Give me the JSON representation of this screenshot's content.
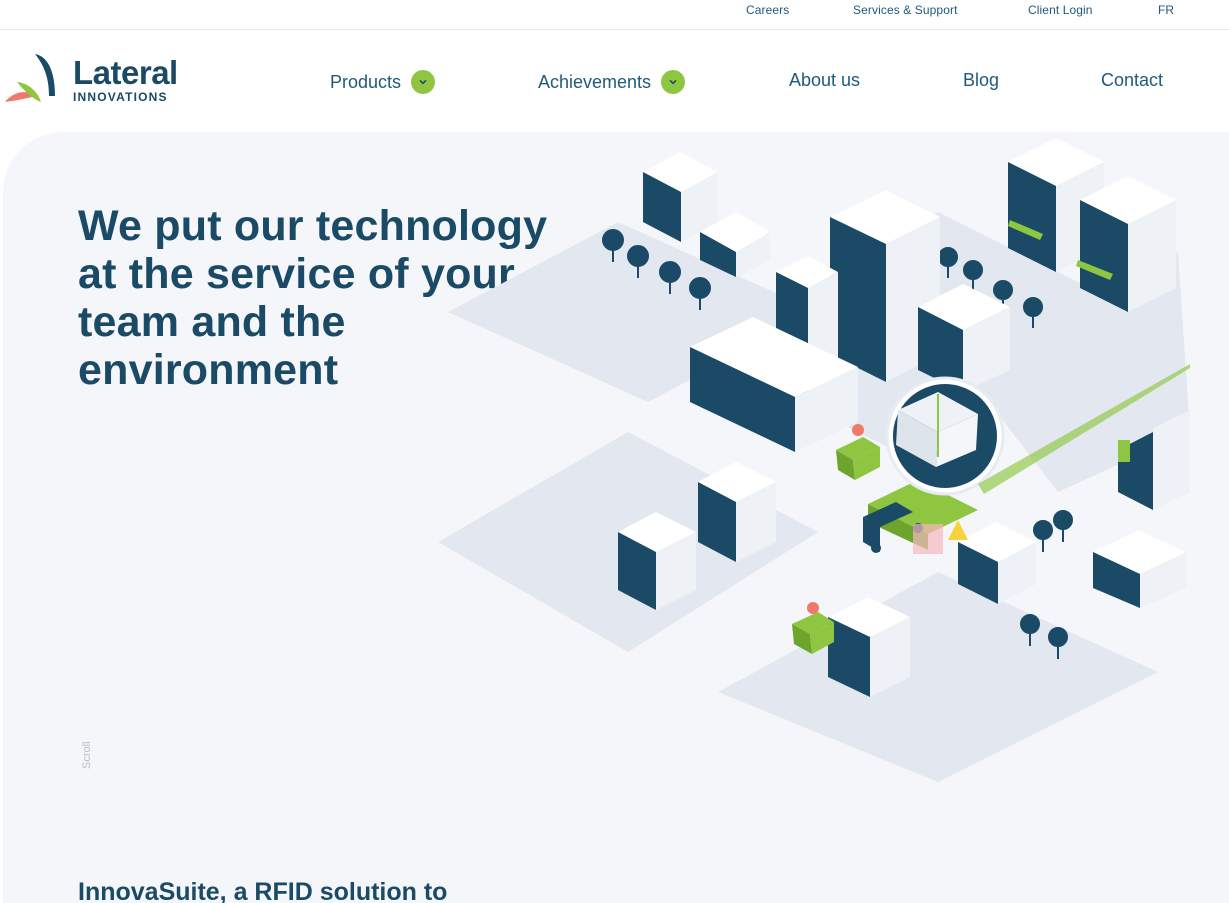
{
  "utility": {
    "careers": "Careers",
    "support": "Services & Support",
    "login": "Client Login",
    "lang": "FR"
  },
  "brand": {
    "name": "Lateral",
    "tagline": "INNOVATIONS"
  },
  "nav": {
    "products": "Products",
    "achievements": "Achievements",
    "about": "About us",
    "blog": "Blog",
    "contact": "Contact"
  },
  "hero": {
    "title": "We put our technology at the service of your team and the environment",
    "scroll": "Scroll"
  },
  "next_section": {
    "title": "InnovaSuite, a RFID solution to"
  },
  "colors": {
    "navy": "#1a4a66",
    "green": "#8fc641",
    "coral": "#f07a6a",
    "hero_bg": "#f4f6f9"
  }
}
